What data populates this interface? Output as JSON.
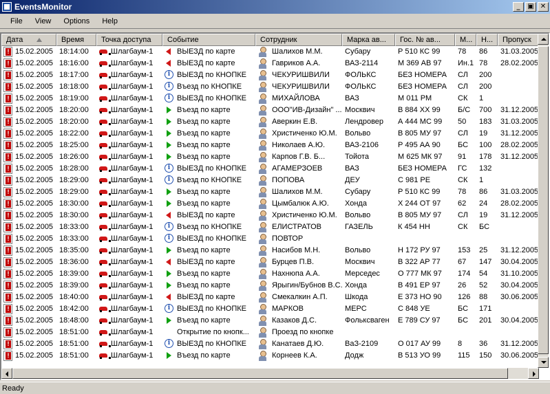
{
  "window": {
    "title": "EventsMonitor",
    "buttons": [
      "_",
      "▣",
      "✕"
    ]
  },
  "menu": [
    "File",
    "View",
    "Options",
    "Help"
  ],
  "columns": [
    "Дата",
    "Время",
    "Точка доступа",
    "Событие",
    "Сотрудник",
    "Марка ав...",
    "Гос. № ав...",
    "М...",
    "Н...",
    "Пропуск"
  ],
  "sort": {
    "column": "Дата",
    "direction": "ascending"
  },
  "rows": [
    {
      "date": "15.02.2005",
      "time": "18:14:00",
      "point": "Шлагбаум-1",
      "event_icon": "exit",
      "event": "ВЫЕЗД по карте",
      "employee": "Шалихов М.М.",
      "brand": "Субару",
      "plate": "Р 510 КС 99",
      "m": "78",
      "n": "86",
      "pass": "31.03.2005"
    },
    {
      "date": "15.02.2005",
      "time": "18:16:00",
      "point": "Шлагбаум-1",
      "event_icon": "exit",
      "event": "ВЫЕЗД по карте",
      "employee": "Гавриков А.А.",
      "brand": "ВАЗ-2114",
      "plate": "М 369 АВ 97",
      "m": "Ин.1",
      "n": "78",
      "pass": "28.02.2005"
    },
    {
      "date": "15.02.2005",
      "time": "18:17:00",
      "point": "Шлагбаум-1",
      "event_icon": "info",
      "event": "ВЫЕЗД по КНОПКЕ",
      "employee": "ЧЕКУРИШВИЛИ",
      "brand": "ФОЛЬКС",
      "plate": "БЕЗ НОМЕРА",
      "m": "СЛ",
      "n": "200",
      "pass": ""
    },
    {
      "date": "15.02.2005",
      "time": "18:18:00",
      "point": "Шлагбаум-1",
      "event_icon": "info",
      "event": "Въезд по КНОПКЕ",
      "employee": "ЧЕКУРИШВИЛИ",
      "brand": "ФОЛЬКС",
      "plate": "БЕЗ НОМЕРА",
      "m": "СЛ",
      "n": "200",
      "pass": ""
    },
    {
      "date": "15.02.2005",
      "time": "18:19:00",
      "point": "Шлагбаум-1",
      "event_icon": "info",
      "event": "ВЫЕЗД по КНОПКЕ",
      "employee": "МИХАЙЛОВА",
      "brand": "ВАЗ",
      "plate": "М 011 РМ",
      "m": "СК",
      "n": "1",
      "pass": ""
    },
    {
      "date": "15.02.2005",
      "time": "18:20:00",
      "point": "Шлагбаум-1",
      "event_icon": "enter",
      "event": "Въезд по карте",
      "employee": "ООО\"ИВ-Дизайн\" ...",
      "brand": "Москвич",
      "plate": "В 884 ХХ 99",
      "m": "Б/С",
      "n": "700",
      "pass": "31.12.2005"
    },
    {
      "date": "15.02.2005",
      "time": "18:20:00",
      "point": "Шлагбаум-1",
      "event_icon": "enter",
      "event": "Въезд по карте",
      "employee": "Аверкин Е.В.",
      "brand": "Лендровер",
      "plate": "А 444 МС 99",
      "m": "50",
      "n": "183",
      "pass": "31.03.2005"
    },
    {
      "date": "15.02.2005",
      "time": "18:22:00",
      "point": "Шлагбаум-1",
      "event_icon": "enter",
      "event": "Въезд по карте",
      "employee": "Христиченко Ю.М.",
      "brand": "Вольво",
      "plate": "В 805 МУ 97",
      "m": "СЛ",
      "n": "19",
      "pass": "31.12.2005"
    },
    {
      "date": "15.02.2005",
      "time": "18:25:00",
      "point": "Шлагбаум-1",
      "event_icon": "enter",
      "event": "Въезд по карте",
      "employee": "Николаев А.Ю.",
      "brand": "ВАЗ-2106",
      "plate": "Р 495 АА 90",
      "m": "БС",
      "n": "100",
      "pass": "28.02.2005"
    },
    {
      "date": "15.02.2005",
      "time": "18:26:00",
      "point": "Шлагбаум-1",
      "event_icon": "enter",
      "event": "Въезд по карте",
      "employee": "Карпов Г.В. Б...",
      "brand": "Тойота",
      "plate": "М 625 МК 97",
      "m": "91",
      "n": "178",
      "pass": "31.12.2005"
    },
    {
      "date": "15.02.2005",
      "time": "18:28:00",
      "point": "Шлагбаум-1",
      "event_icon": "info",
      "event": "ВЫЕЗД по КНОПКЕ",
      "employee": "АГАМЕРЗОЕВ",
      "brand": "ВАЗ",
      "plate": "БЕЗ НОМЕРА",
      "m": "ГС",
      "n": "132",
      "pass": ""
    },
    {
      "date": "15.02.2005",
      "time": "18:29:00",
      "point": "Шлагбаум-1",
      "event_icon": "info",
      "event": "Въезд по КНОПКЕ",
      "employee": "ПОПОВА",
      "brand": "ДЕУ",
      "plate": "С 981 РЕ",
      "m": "СК",
      "n": "1",
      "pass": ""
    },
    {
      "date": "15.02.2005",
      "time": "18:29:00",
      "point": "Шлагбаум-1",
      "event_icon": "enter",
      "event": "Въезд по карте",
      "employee": "Шалихов М.М.",
      "brand": "Субару",
      "plate": "Р 510 КС 99",
      "m": "78",
      "n": "86",
      "pass": "31.03.2005"
    },
    {
      "date": "15.02.2005",
      "time": "18:30:00",
      "point": "Шлагбаум-1",
      "event_icon": "enter",
      "event": "Въезд по карте",
      "employee": "Цымбалюк А.Ю.",
      "brand": "Хонда",
      "plate": "Х 244 ОТ 97",
      "m": "62",
      "n": "24",
      "pass": "28.02.2005"
    },
    {
      "date": "15.02.2005",
      "time": "18:30:00",
      "point": "Шлагбаум-1",
      "event_icon": "exit",
      "event": "ВЫЕЗД по карте",
      "employee": "Христиченко Ю.М.",
      "brand": "Вольво",
      "plate": "В 805 МУ 97",
      "m": "СЛ",
      "n": "19",
      "pass": "31.12.2005"
    },
    {
      "date": "15.02.2005",
      "time": "18:33:00",
      "point": "Шлагбаум-1",
      "event_icon": "info",
      "event": "Въезд по КНОПКЕ",
      "employee": "ЕЛИСТРАТОВ",
      "brand": "ГАЗЕЛЬ",
      "plate": "К 454 НН",
      "m": "СК",
      "n": "БС",
      "pass": ""
    },
    {
      "date": "15.02.2005",
      "time": "18:33:00",
      "point": "Шлагбаум-1",
      "event_icon": "info",
      "event": "ВЫЕЗД по КНОПКЕ",
      "employee": "ПОВТОР",
      "brand": "",
      "plate": "",
      "m": "",
      "n": "",
      "pass": ""
    },
    {
      "date": "15.02.2005",
      "time": "18:35:00",
      "point": "Шлагбаум-1",
      "event_icon": "enter",
      "event": "Въезд по карте",
      "employee": "Насибов М.Н.",
      "brand": "Вольво",
      "plate": "Н 172 РУ 97",
      "m": "153",
      "n": "25",
      "pass": "31.12.2005"
    },
    {
      "date": "15.02.2005",
      "time": "18:36:00",
      "point": "Шлагбаум-1",
      "event_icon": "exit",
      "event": "ВЫЕЗД по карте",
      "employee": "Бурцев П.В.",
      "brand": "Москвич",
      "plate": "В 322 АР 77",
      "m": "67",
      "n": "147",
      "pass": "30.04.2005"
    },
    {
      "date": "15.02.2005",
      "time": "18:39:00",
      "point": "Шлагбаум-1",
      "event_icon": "enter",
      "event": "Въезд по карте",
      "employee": "Нахнюпа А.А.",
      "brand": "Мерседес",
      "plate": "О 777 МК 97",
      "m": "174",
      "n": "54",
      "pass": "31.10.2005"
    },
    {
      "date": "15.02.2005",
      "time": "18:39:00",
      "point": "Шлагбаум-1",
      "event_icon": "enter",
      "event": "Въезд по карте",
      "employee": "Ярыгин/Бубнов В.С.",
      "brand": "Хонда",
      "plate": "В 491 ЕР 97",
      "m": "26",
      "n": "52",
      "pass": "30.04.2005"
    },
    {
      "date": "15.02.2005",
      "time": "18:40:00",
      "point": "Шлагбаум-1",
      "event_icon": "exit",
      "event": "ВЫЕЗД по карте",
      "employee": "Смекалкин  А.П.",
      "brand": "Шкода",
      "plate": "Е 373 НО 90",
      "m": "126",
      "n": "88",
      "pass": "30.06.2005"
    },
    {
      "date": "15.02.2005",
      "time": "18:42:00",
      "point": "Шлагбаум-1",
      "event_icon": "info",
      "event": "ВЫЕЗД по КНОПКЕ",
      "employee": "МАРКОВ",
      "brand": "МЕРС",
      "plate": "С 848 УЕ",
      "m": "БС",
      "n": "171",
      "pass": ""
    },
    {
      "date": "15.02.2005",
      "time": "18:48:00",
      "point": "Шлагбаум-1",
      "event_icon": "enter",
      "event": "Въезд по карте",
      "employee": "Казаков Д.С.",
      "brand": "Фольксваген",
      "plate": "Е 789 СУ 97",
      "m": "БС",
      "n": "201",
      "pass": "30.04.2005"
    },
    {
      "date": "15.02.2005",
      "time": "18:51:00",
      "point": "Шлагбаум-1",
      "event_icon": "none",
      "event": "Открытие по кнопк...",
      "employee": "Проезд по кнопке",
      "brand": "",
      "plate": "",
      "m": "",
      "n": "",
      "pass": ""
    },
    {
      "date": "15.02.2005",
      "time": "18:51:00",
      "point": "Шлагбаум-1",
      "event_icon": "info",
      "event": "ВЫЕЗД по КНОПКЕ",
      "employee": "Канатаев  Д.Ю.",
      "brand": "ВаЗ-2109",
      "plate": "О 017 АУ 99",
      "m": "8",
      "n": "36",
      "pass": "31.12.2005"
    },
    {
      "date": "15.02.2005",
      "time": "18:51:00",
      "point": "Шлагбаум-1",
      "event_icon": "enter",
      "event": "Въезд по карте",
      "employee": "Корнеев К.А.",
      "brand": "Додж",
      "plate": "В 513 УО 99",
      "m": "115",
      "n": "150",
      "pass": "30.06.2005"
    }
  ],
  "status": {
    "text": "Ready"
  }
}
